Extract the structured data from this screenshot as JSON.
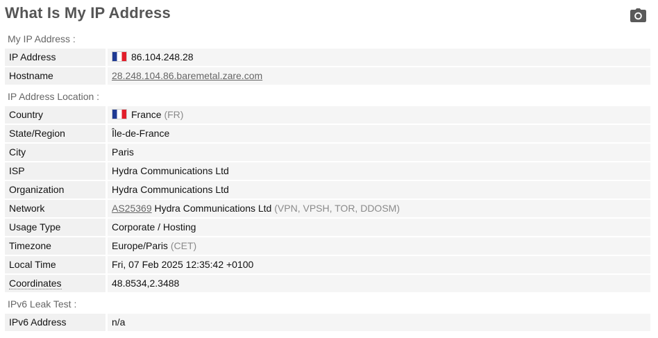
{
  "page": {
    "title": "What Is My IP Address"
  },
  "icons": {
    "camera": "camera-icon",
    "flag": "flag-france-icon"
  },
  "colors": {
    "title": "#555555",
    "label_bg": "#f1f1f1",
    "value_bg": "#f5f5f5",
    "muted": "#8a8a8a"
  },
  "my_ip": {
    "heading": "My IP Address :",
    "ip_label": "IP Address",
    "ip_value": "86.104.248.28",
    "hostname_label": "Hostname",
    "hostname_value": "28.248.104.86.baremetal.zare.com"
  },
  "location": {
    "heading": "IP Address Location :",
    "country_label": "Country",
    "country_value": "France",
    "country_code": "(FR)",
    "region_label": "State/Region",
    "region_value": "Île-de-France",
    "city_label": "City",
    "city_value": "Paris",
    "isp_label": "ISP",
    "isp_value": "Hydra Communications Ltd",
    "org_label": "Organization",
    "org_value": "Hydra Communications Ltd",
    "network_label": "Network",
    "network_asn": "AS25369",
    "network_name": "Hydra Communications Ltd",
    "network_tags": "(VPN, VPSH, TOR, DDOSM)",
    "usage_label": "Usage Type",
    "usage_value": "Corporate / Hosting",
    "tz_label": "Timezone",
    "tz_value": "Europe/Paris",
    "tz_abbr": "(CET)",
    "time_label": "Local Time",
    "time_value": "Fri, 07 Feb 2025 12:35:42 +0100",
    "coords_label": "Coordinates",
    "coords_value": "48.8534,2.3488"
  },
  "ipv6": {
    "heading": "IPv6 Leak Test :",
    "label": "IPv6 Address",
    "value": "n/a"
  }
}
